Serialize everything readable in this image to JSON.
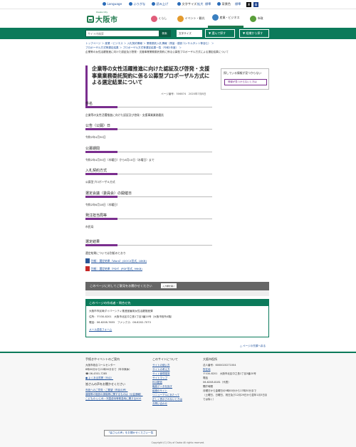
{
  "util": {
    "language": "Language",
    "furigana": "ふりがな",
    "read_aloud": "読み上げ",
    "font_size_label": "文字サイズ",
    "font_size_up": "拡大",
    "font_size_std": "標準",
    "color_label": "背景色",
    "color_std": "標準",
    "color_black": "黒",
    "color_blue": "青"
  },
  "header": {
    "logo_sub": "Osaka City",
    "logo_name": "大阪市",
    "nav": [
      {
        "label": "くらし",
        "color": "#e05d7a"
      },
      {
        "label": "イベント・観光",
        "color": "#e39a2d"
      },
      {
        "label": "産業・ビジネス",
        "color": "#3a7fc0"
      },
      {
        "label": "市政",
        "color": "#5a9e3a"
      }
    ]
  },
  "search": {
    "placeholder": "サイト内検索",
    "button": "検索",
    "font_size": "文字サイズ",
    "btn1": "選んで探す",
    "btn2": "組織から探す"
  },
  "breadcrumb": {
    "items": [
      "トップページ",
      "産業・ビジネス",
      "入札契約情報",
      "業務委託入札情報（測量・建設コンサルタント等含む）",
      "プロポーザル方式等選定結果",
      "プロポーザル方式等選定結果一覧（令和2年度）"
    ],
    "current": "企業等の女性活躍推進に向けた認証及び啓発・支援事業業務委託契約に係る公募型プロポーザル方式による選定結果について"
  },
  "main": {
    "title": "企業等の女性活躍推進に向けた認証及び啓発・支援事業業務委託契約に係る公募型プロポーザル方式による選定結果について",
    "page_no": "ページ番号：506874　2020年7月8日"
  },
  "sections": [
    {
      "heading": "件名",
      "text": "企業等の女性活躍推進に向けた認証及び啓発・支援事業業務委託"
    },
    {
      "heading": "公告（公開）日",
      "text": "令和2年4月30日"
    },
    {
      "heading": "公募期間",
      "text": "令和2年4月30日（木曜日）から6月10日（水曜日）まで"
    },
    {
      "heading": "入札契約方式",
      "text": "公募型プロポーザル方式"
    },
    {
      "heading": "選定会議（委員会）の開催日",
      "text": "令和2年6月18日（木曜日）"
    },
    {
      "heading": "発注担当局等",
      "text": "市民局"
    },
    {
      "heading": "選定結果",
      "text": "選定結果については別紙のとおり"
    }
  ],
  "downloads": [
    {
      "label": "別紙：選定結果（Word）(DOCX形式, 18KB)"
    },
    {
      "label": "別紙：選定結果（PDF）(PDF形式, 99KB)"
    }
  ],
  "sidebar": {
    "title": "探している情報が見つからない",
    "button": "情報が見つからないときは"
  },
  "feedback": {
    "title": "このページに対してご意見をお聞かせください",
    "button": "入力欄を開く"
  },
  "contact": {
    "heading": "このページの作成者・問合せ先",
    "lines": [
      "大阪市市民局ダイバーシティ推進室雇用女性活躍推進課",
      "住所：〒530-8201　大阪市北区中之島1丁目3番20号（大阪市役所4階）",
      "電話：06-6208-7655　ファックス：06-6202-7073"
    ],
    "mail": "メール送信フォーム"
  },
  "to_top": "ページの先頭へ戻る",
  "footer": {
    "col1": {
      "h": "手続きやイベントのご案内",
      "p1": "大阪市総合コールセンター",
      "p2": "8時00分から21時00分まで（年中無休）",
      "tel": "06-4301-7285",
      "faq": "よくある質問（FAQ）",
      "h2": "皆さんの声をお聞かせください",
      "links": [
        "市政へのご意見・ご要望（市民の声）",
        "道路等の施設の損傷等に関するものは（公益通報）",
        "こどもの いじめ・児童虐待等緊急時に関するSOS"
      ]
    },
    "col2": {
      "h": "このサイトについて",
      "links": [
        "サイトの使い方",
        "サイトの考え方",
        "サイト管理運営",
        "サイトマップ",
        "RSS配信",
        "職員データを探す",
        "組織のサイト",
        "リニューアルにあたって",
        "正しく表示されないときは",
        "お問い合わせ"
      ]
    },
    "col3": {
      "h": "大阪市役所",
      "corp": "法人番号：6000020271004",
      "map": "所在地",
      "addr": "〒530-8201　大阪市北区中之島1丁目3番20号",
      "tel_h": "電話",
      "tel": "06-6208-8181（代表）",
      "hours_h": "開庁時間",
      "hours": "月曜日から金曜日の9時00分から17時30分まで",
      "hours2": "（土曜日、日曜日、祝日及び12月29日から翌年1月3日までは除く）"
    },
    "voice": "「皆さんの声」をお聞かせください一覧",
    "copyright": "Copyright (C) City of Osaka All rights reserved."
  }
}
